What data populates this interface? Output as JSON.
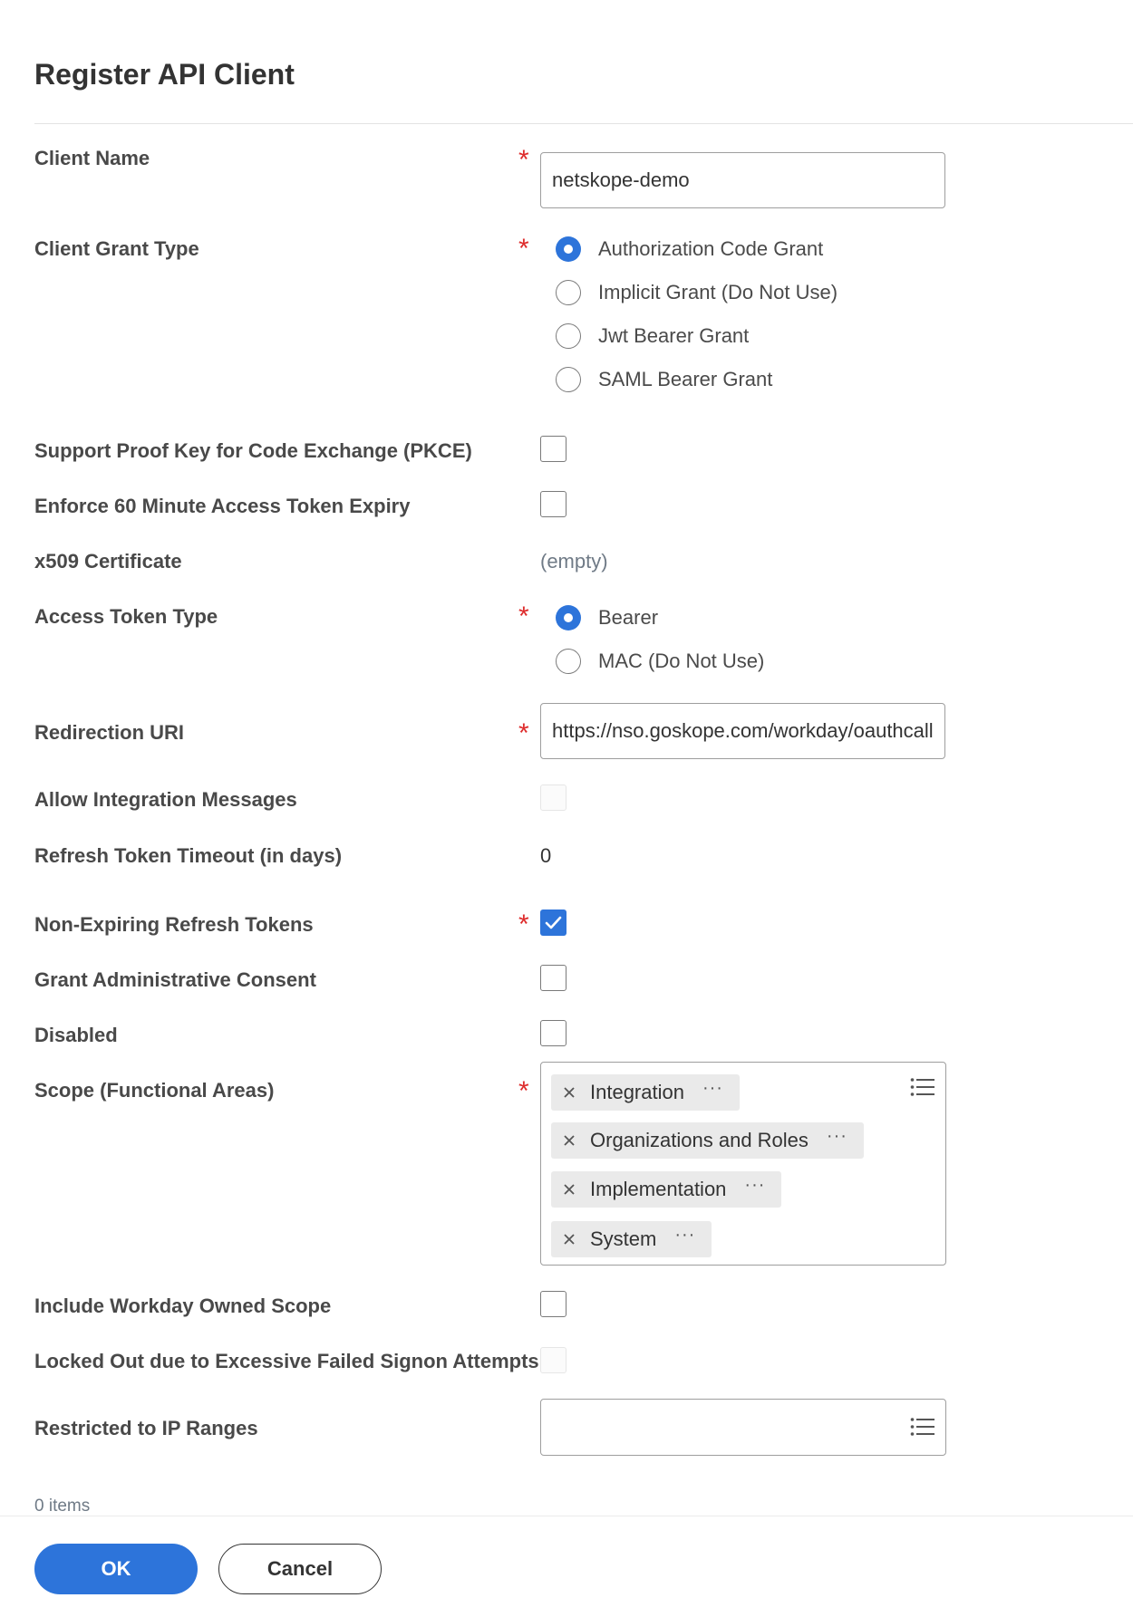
{
  "page": {
    "title": "Register API Client"
  },
  "fields": {
    "client_name": {
      "label": "Client Name",
      "value": "netskope-demo"
    },
    "grant_type": {
      "label": "Client Grant Type",
      "options": [
        "Authorization Code Grant",
        "Implicit Grant (Do Not Use)",
        "Jwt Bearer Grant",
        "SAML Bearer Grant"
      ],
      "selected": "Authorization Code Grant"
    },
    "pkce": {
      "label": "Support Proof Key for Code Exchange (PKCE)",
      "checked": false
    },
    "enforce_expiry": {
      "label": "Enforce 60 Minute Access Token Expiry",
      "checked": false
    },
    "x509": {
      "label": "x509 Certificate",
      "value": "(empty)"
    },
    "access_token_type": {
      "label": "Access Token Type",
      "options": [
        "Bearer",
        "MAC (Do Not Use)"
      ],
      "selected": "Bearer"
    },
    "redirect_uri": {
      "label": "Redirection URI",
      "value": "https://nso.goskope.com/workday/oauthcallback"
    },
    "allow_integration": {
      "label": "Allow Integration Messages",
      "checked": false,
      "disabled": true
    },
    "refresh_timeout": {
      "label": "Refresh Token Timeout (in days)",
      "value": "0"
    },
    "non_expiring": {
      "label": "Non-Expiring Refresh Tokens",
      "checked": true
    },
    "admin_consent": {
      "label": "Grant Administrative Consent",
      "checked": false
    },
    "disabled": {
      "label": "Disabled",
      "checked": false
    },
    "scope": {
      "label": "Scope (Functional Areas)",
      "items": [
        "Integration",
        "Organizations and Roles",
        "Implementation",
        "System"
      ]
    },
    "workday_owned": {
      "label": "Include Workday Owned Scope",
      "checked": false
    },
    "locked_out": {
      "label": "Locked Out due to Excessive Failed Signon Attempts",
      "checked": false,
      "disabled": true
    },
    "ip_ranges": {
      "label": "Restricted to IP Ranges",
      "items": []
    }
  },
  "items_count": "0 items",
  "required_marker": "*",
  "buttons": {
    "ok": "OK",
    "cancel": "Cancel"
  },
  "colors": {
    "accent": "#2d74da",
    "required": "#de2c2c"
  },
  "icons": {
    "prompt": "list-icon",
    "remove": "close-icon",
    "related_actions": "more-icon"
  }
}
